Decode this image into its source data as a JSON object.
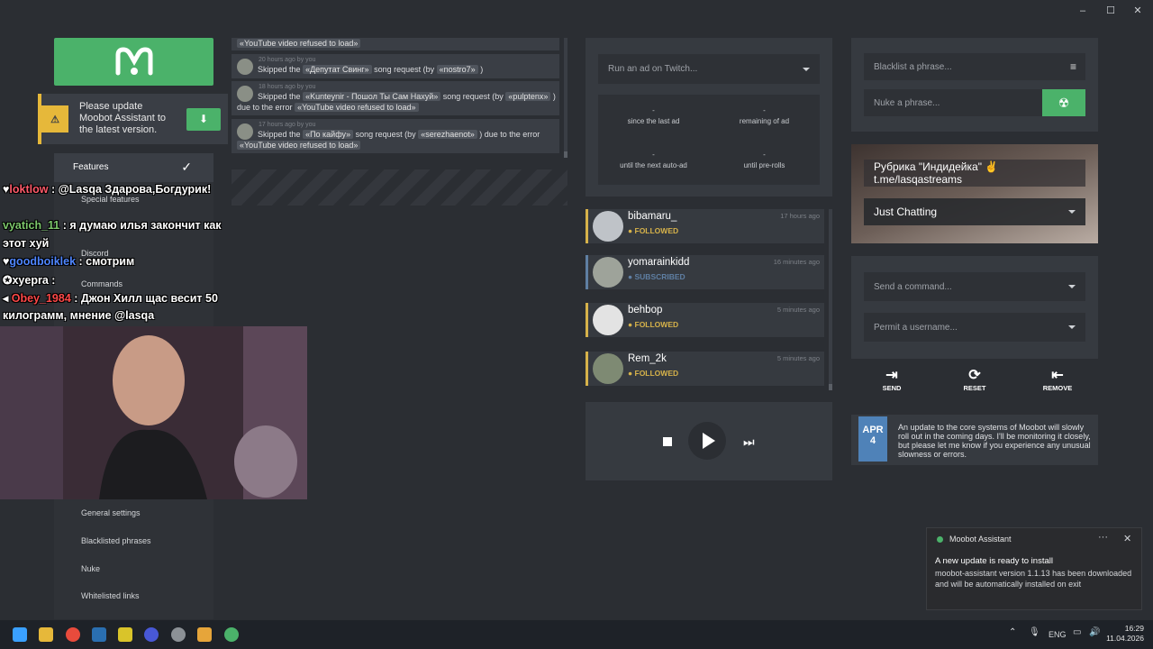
{
  "window": {
    "controls": [
      "–",
      "☐",
      "✕"
    ]
  },
  "update_notice": {
    "text": "Please update Moobot Assistant to the latest version."
  },
  "nav": {
    "active": "Features",
    "items": [
      "Special features",
      "Discord",
      "Commands",
      "General settings",
      "Blacklisted phrases",
      "Nuke",
      "Whitelisted links"
    ]
  },
  "chat": [
    {
      "user": "loktlow",
      "text": " : @Lasqa Здарова,Богдурик!",
      "color": "#ff5a6a"
    },
    {
      "user": "vyatich_11",
      "text": " : я думаю илья закончит как",
      "color": "#7cc76b"
    },
    {
      "user": "",
      "text": "этот хуй",
      "color": "#ffffff"
    },
    {
      "user": "goodboiklek",
      "text": " : смотрим",
      "color": "#4f86ff"
    },
    {
      "user": "xyepra",
      "text": " : ",
      "color": "#ffffff"
    },
    {
      "user": "Obey_1984",
      "text": " : Джон Хилл щас весит 50",
      "color": "#ff4848"
    },
    {
      "user": "",
      "text": "килограмм, мнение @lasqa",
      "color": "#ffffff"
    }
  ],
  "song_log": [
    {
      "time": "",
      "parts": [
        "«YouTube video refused to load»"
      ]
    },
    {
      "time": "20 hours ago by you",
      "parts": [
        "Skipped the",
        "«Депутат Свинг»",
        "song request (by",
        "«nostro7»",
        ")"
      ]
    },
    {
      "time": "18 hours ago by you",
      "parts": [
        "Skipped the",
        "«Kunteynir - Пошол Ты Сам Нахуй»",
        "song request (by",
        "«pulptenx»",
        ")",
        "due to the error",
        "«YouTube video refused to load»"
      ]
    },
    {
      "time": "17 hours ago by you",
      "parts": [
        "Skipped the",
        "«По кайфу»",
        "song request (by",
        "«serezhaenot»",
        ") due to the error",
        "«YouTube video refused to load»"
      ]
    }
  ],
  "ads": {
    "placeholder": "Run an ad on Twitch...",
    "cells": [
      {
        "value": "-",
        "label": "since the last ad"
      },
      {
        "value": "-",
        "label": "remaining of ad"
      },
      {
        "value": "-",
        "label": "until the next auto-ad"
      },
      {
        "value": "-",
        "label": "until pre-rolls"
      }
    ]
  },
  "events": [
    {
      "name": "bibamaru_",
      "status": "● FOLLOWED",
      "ago": "17 hours ago",
      "color": "#d6b24a"
    },
    {
      "name": "yomarainkidd",
      "status": "● SUBSCRIBED",
      "ago": "16 minutes ago",
      "color": "#5f7fa3"
    },
    {
      "name": "behbop",
      "status": "● FOLLOWED",
      "ago": "5 minutes ago",
      "color": "#d6b24a"
    },
    {
      "name": "Rem_2k",
      "status": "● FOLLOWED",
      "ago": "5 minutes ago",
      "color": "#d6b24a"
    }
  ],
  "right": {
    "blacklist_placeholder": "Blacklist a phrase...",
    "nuke_placeholder": "Nuke a phrase...",
    "stream_title": "Рубрика \"Индидейка\" ✌ t.me/lasqastreams",
    "stream_category": "Just Chatting",
    "command_placeholder": "Send a command...",
    "permit_placeholder": "Permit a username...",
    "actions": [
      "SEND",
      "RESET",
      "REMOVE"
    ]
  },
  "news": {
    "month": "APR",
    "day": "4",
    "text": "An update to the core systems of Moobot will slowly roll out in the coming days. I'll be monitoring it closely, but please let me know if you experience any unusual slowness or errors."
  },
  "toast": {
    "app": "Moobot Assistant",
    "title": "A new update is ready to install",
    "body": "moobot-assistant version 1.1.13 has been downloaded and will be automatically installed on exit"
  },
  "taskbar": {
    "lang": "ENG",
    "time": "16:29",
    "date": "11.04.2026"
  }
}
